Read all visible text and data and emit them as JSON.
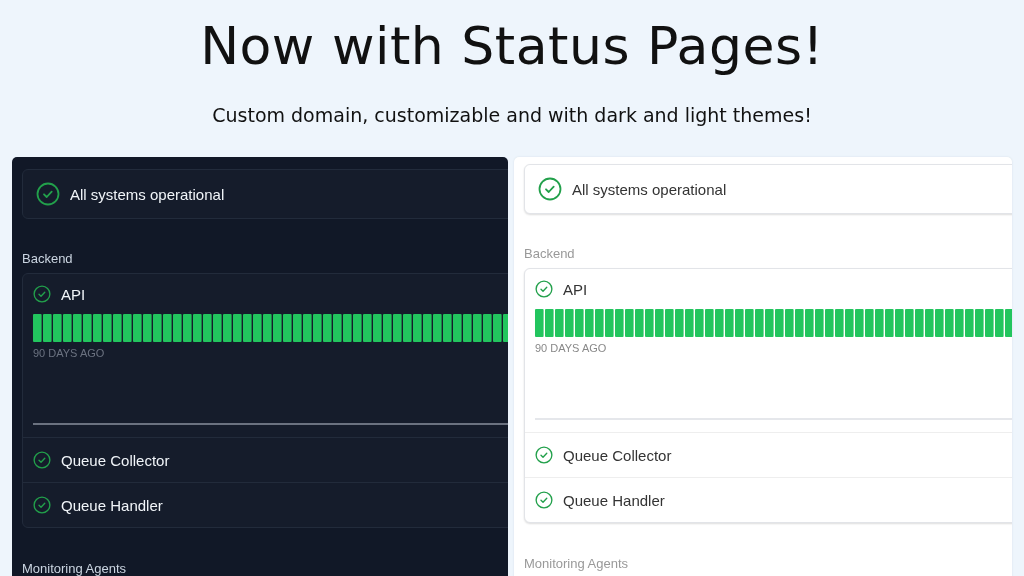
{
  "headline": "Now with Status Pages!",
  "subheadline": "Custom domain, customizable and with dark and light themes!",
  "previews": [
    {
      "kind": "dark",
      "status": "All systems operational",
      "group": "Backend",
      "services": [
        {
          "name": "API",
          "expanded": true,
          "range_label": "90 DAYS AGO"
        },
        {
          "name": "Queue Collector",
          "expanded": false
        },
        {
          "name": "Queue Handler",
          "expanded": false
        }
      ],
      "next_group": "Monitoring Agents"
    },
    {
      "kind": "light",
      "status": "All systems operational",
      "group": "Backend",
      "services": [
        {
          "name": "API",
          "expanded": true,
          "range_label": "90 DAYS AGO"
        },
        {
          "name": "Queue Collector",
          "expanded": false
        },
        {
          "name": "Queue Handler",
          "expanded": false
        }
      ],
      "next_group": "Monitoring Agents"
    }
  ]
}
